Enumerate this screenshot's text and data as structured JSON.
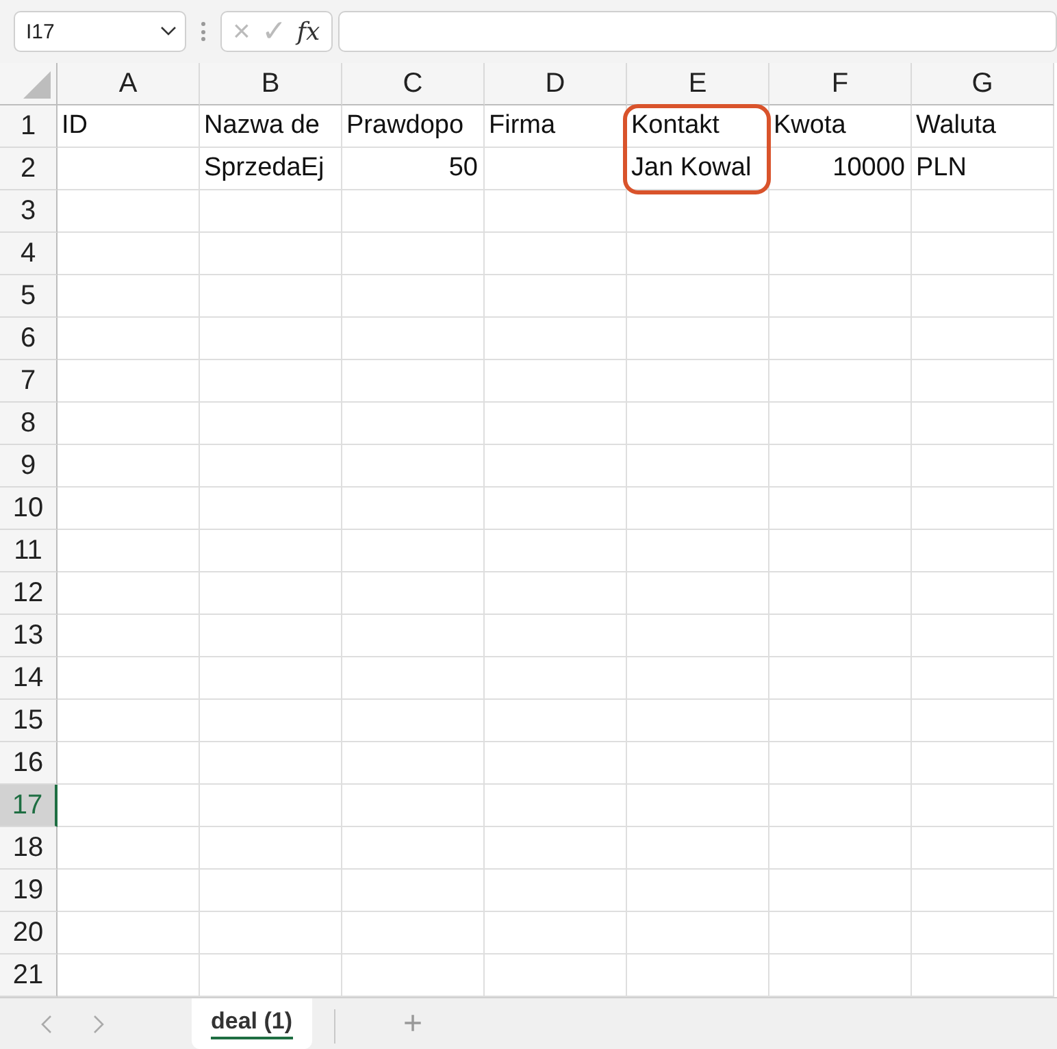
{
  "name_box": {
    "value": "I17"
  },
  "formula_bar": {
    "cancel": "×",
    "enter": "✓",
    "function": "fx"
  },
  "columns": [
    {
      "label": "A",
      "selected": false
    },
    {
      "label": "B",
      "selected": false
    },
    {
      "label": "C",
      "selected": false
    },
    {
      "label": "D",
      "selected": false
    },
    {
      "label": "E",
      "selected": false
    },
    {
      "label": "F",
      "selected": false
    },
    {
      "label": "G",
      "selected": false
    }
  ],
  "rows": [
    {
      "label": "1",
      "selected": false,
      "cells": [
        {
          "text": "ID",
          "kind": "text",
          "highlighted": false
        },
        {
          "text": "Nazwa de",
          "kind": "text",
          "highlighted": false
        },
        {
          "text": "Prawdopo",
          "kind": "text",
          "highlighted": false
        },
        {
          "text": "Firma",
          "kind": "text",
          "highlighted": false
        },
        {
          "text": "Kontakt",
          "kind": "text",
          "highlighted": true
        },
        {
          "text": "Kwota",
          "kind": "text",
          "highlighted": false
        },
        {
          "text": "Waluta",
          "kind": "text",
          "highlighted": false
        }
      ]
    },
    {
      "label": "2",
      "selected": false,
      "cells": [
        null,
        {
          "text": "SprzedaEj",
          "kind": "text",
          "highlighted": false
        },
        {
          "text": "50",
          "kind": "number",
          "highlighted": false
        },
        null,
        {
          "text": "Jan Kowal",
          "kind": "text",
          "highlighted": true
        },
        {
          "text": "10000",
          "kind": "number",
          "highlighted": false
        },
        {
          "text": "PLN",
          "kind": "text",
          "highlighted": false
        }
      ]
    },
    {
      "label": "3",
      "selected": false
    },
    {
      "label": "4",
      "selected": false
    },
    {
      "label": "5",
      "selected": false
    },
    {
      "label": "6",
      "selected": false
    },
    {
      "label": "7",
      "selected": false
    },
    {
      "label": "8",
      "selected": false
    },
    {
      "label": "9",
      "selected": false
    },
    {
      "label": "10",
      "selected": false
    },
    {
      "label": "11",
      "selected": false
    },
    {
      "label": "12",
      "selected": false
    },
    {
      "label": "13",
      "selected": false
    },
    {
      "label": "14",
      "selected": false
    },
    {
      "label": "15",
      "selected": false
    },
    {
      "label": "16",
      "selected": false
    },
    {
      "label": "17",
      "selected": true
    },
    {
      "label": "18",
      "selected": false
    },
    {
      "label": "19",
      "selected": false
    },
    {
      "label": "20",
      "selected": false
    },
    {
      "label": "21",
      "selected": false
    }
  ],
  "sheet_tabs": [
    {
      "label": "deal (1)",
      "selected": true
    }
  ],
  "add_sheet": "+"
}
